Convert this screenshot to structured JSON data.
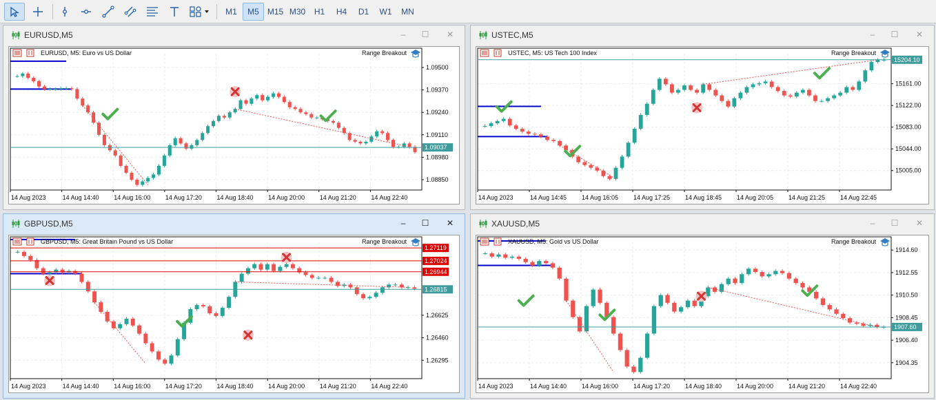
{
  "toolbar": {
    "tools": [
      {
        "name": "cursor-tool-button",
        "icon": "cursor-icon",
        "active": true
      },
      {
        "name": "crosshair-tool-button",
        "icon": "crosshair-icon",
        "active": false
      },
      {
        "name": "vertical-line-tool-button",
        "icon": "vertical-line-icon",
        "active": false
      },
      {
        "name": "horizontal-line-tool-button",
        "icon": "horizontal-line-icon",
        "active": false
      },
      {
        "name": "trendline-tool-button",
        "icon": "trendline-icon",
        "active": false
      },
      {
        "name": "channel-tool-button",
        "icon": "channel-icon",
        "active": false
      },
      {
        "name": "fibonacci-tool-button",
        "icon": "fibonacci-icon",
        "active": false
      },
      {
        "name": "text-tool-button",
        "icon": "text-icon",
        "active": false
      },
      {
        "name": "shapes-tool-button",
        "icon": "shapes-icon",
        "active": false
      }
    ],
    "timeframes": [
      "M1",
      "M5",
      "M15",
      "M30",
      "H1",
      "H4",
      "D1",
      "W1",
      "MN"
    ],
    "active_timeframe": "M5"
  },
  "colors": {
    "bull": "#26a69a",
    "bear": "#ef5350",
    "blue_line": "#0000cc",
    "price_line": "#3f9c9c",
    "red_level": "#e00000",
    "check": "#4caf50",
    "cross": "#d33434"
  },
  "windows": [
    {
      "key": "eurusd",
      "title": "EURUSD,M5",
      "description": "EURUSD, M5:  Euro vs US Dollar",
      "indicator": "Range Breakout",
      "active": false,
      "y_ticks": [
        "1.09500",
        "1.09370",
        "1.09240",
        "1.09110",
        "1.08980",
        "1.08850"
      ],
      "price_tag": "1.09037",
      "level_tags": [],
      "x_ticks": [
        "14 Aug 2023",
        "14 Aug 14:40",
        "14 Aug 16:00",
        "14 Aug 17:20",
        "14 Aug 18:40",
        "14 Aug 20:00",
        "14 Aug 21:20",
        "14 Aug 22:40"
      ],
      "chart_data": {
        "type": "candlestick",
        "ylim": [
          1.0879,
          1.0958
        ],
        "close": [
          1.0945,
          1.09465,
          1.0944,
          1.0942,
          1.0939,
          1.09375,
          1.09375,
          1.09375,
          1.0938,
          1.0938,
          1.09375,
          1.0932,
          1.0928,
          1.0924,
          1.0918,
          1.0911,
          1.0905,
          1.0902,
          1.0899,
          1.0893,
          1.0889,
          1.0885,
          1.0882,
          1.0884,
          1.0886,
          1.0888,
          1.0893,
          1.0899,
          1.0905,
          1.0909,
          1.0906,
          1.0903,
          1.0905,
          1.0908,
          1.0912,
          1.0916,
          1.0919,
          1.0922,
          1.0921,
          1.0924,
          1.0926,
          1.0931,
          1.0929,
          1.0932,
          1.0934,
          1.0931,
          1.0933,
          1.0935,
          1.0933,
          1.093,
          1.0927,
          1.0926,
          1.0924,
          1.0923,
          1.0921,
          1.0921,
          1.092,
          1.0919,
          1.0918,
          1.0915,
          1.0912,
          1.0908,
          1.0907,
          1.0906,
          1.0907,
          1.091,
          1.0913,
          1.0912,
          1.0908,
          1.0904,
          1.0904,
          1.0906,
          1.0904,
          1.0901
        ]
      },
      "markers": [
        {
          "kind": "check",
          "i": 17,
          "y": 1.0923
        },
        {
          "kind": "cross",
          "i": 40,
          "y": 1.0936
        },
        {
          "kind": "check",
          "i": 57,
          "y": 1.0922
        }
      ]
    },
    {
      "key": "ustec",
      "title": "USTEC,M5",
      "description": "USTEC, M5:  US Tech 100 Index",
      "indicator": "Range Breakout",
      "active": false,
      "y_ticks": [
        "15161.00",
        "15122.00",
        "15083.00",
        "15044.00",
        "15005.00"
      ],
      "price_tag": "15204.10",
      "level_tags": [],
      "x_ticks": [
        "14 Aug 2023",
        "14 Aug 14:45",
        "14 Aug 16:05",
        "14 Aug 17:25",
        "14 Aug 18:45",
        "14 Aug 20:05",
        "14 Aug 21:25",
        "14 Aug 22:45"
      ],
      "chart_data": {
        "type": "candlestick",
        "ylim": [
          14970,
          15215
        ],
        "close": [
          15085,
          15090,
          15094,
          15098,
          15086,
          15080,
          15075,
          15071,
          15070,
          15066,
          15060,
          15058,
          15050,
          15042,
          15030,
          15020,
          15015,
          15010,
          15005,
          14995,
          14990,
          15010,
          15030,
          15055,
          15080,
          15105,
          15125,
          15150,
          15170,
          15160,
          15145,
          15150,
          15158,
          15150,
          15145,
          15160,
          15150,
          15140,
          15130,
          15120,
          15135,
          15145,
          15155,
          15160,
          15162,
          15165,
          15155,
          15148,
          15140,
          15138,
          15145,
          15150,
          15140,
          15130,
          15130,
          15135,
          15140,
          15145,
          15155,
          15150,
          15165,
          15185,
          15200,
          15204,
          15204
        ]
      },
      "markers": [
        {
          "kind": "check",
          "i": 3,
          "y": 15120
        },
        {
          "kind": "check",
          "i": 14,
          "y": 15040
        },
        {
          "kind": "cross",
          "i": 34,
          "y": 15118
        },
        {
          "kind": "check",
          "i": 54,
          "y": 15180
        }
      ]
    },
    {
      "key": "gbpusd",
      "title": "GBPUSD,M5",
      "description": "GBPUSD, M5:  Great Britain Pound vs US Dollar",
      "indicator": "Range Breakout",
      "active": true,
      "y_ticks": [
        "1.26625",
        "1.26460",
        "1.26295"
      ],
      "price_tag": "1.26815",
      "level_tags": [
        "1.27119",
        "1.27024",
        "1.26944"
      ],
      "x_ticks": [
        "14 Aug 2023",
        "14 Aug 14:40",
        "14 Aug 16:00",
        "14 Aug 17:20",
        "14 Aug 18:40",
        "14 Aug 20:00",
        "14 Aug 21:20",
        "14 Aug 22:40"
      ],
      "chart_data": {
        "type": "candlestick",
        "ylim": [
          1.2616,
          1.2716
        ],
        "close": [
          1.2709,
          1.2706,
          1.2703,
          1.2697,
          1.2693,
          1.2694,
          1.2696,
          1.2694,
          1.2695,
          1.2693,
          1.2687,
          1.268,
          1.2672,
          1.2665,
          1.2658,
          1.2653,
          1.2656,
          1.266,
          1.2655,
          1.2649,
          1.2642,
          1.2636,
          1.263,
          1.2627,
          1.2633,
          1.2645,
          1.2657,
          1.2667,
          1.267,
          1.2669,
          1.2664,
          1.2662,
          1.2668,
          1.2676,
          1.2687,
          1.2693,
          1.2697,
          1.27,
          1.2696,
          1.27,
          1.2695,
          1.2698,
          1.27,
          1.2697,
          1.2694,
          1.2692,
          1.269,
          1.269,
          1.269,
          1.2687,
          1.2684,
          1.2685,
          1.2683,
          1.2678,
          1.2675,
          1.2676,
          1.2679,
          1.2683,
          1.2685,
          1.2685,
          1.2683,
          1.2683,
          1.2682
        ]
      },
      "markers": [
        {
          "kind": "cross",
          "i": 5,
          "y": 1.2688
        },
        {
          "kind": "check",
          "i": 26,
          "y": 1.2658
        },
        {
          "kind": "cross",
          "i": 36,
          "y": 1.2648
        },
        {
          "kind": "cross",
          "i": 42,
          "y": 1.2705
        }
      ]
    },
    {
      "key": "xauusd",
      "title": "XAUUSD,M5",
      "description": "XAUUSD, M5:  Gold vs US Dollar",
      "indicator": "Range Breakout",
      "active": false,
      "y_ticks": [
        "1914.60",
        "1912.55",
        "1910.50",
        "1908.45",
        "1906.40",
        "1904.35"
      ],
      "price_tag": "1907.60",
      "level_tags": [],
      "x_ticks": [
        "14 Aug 2023",
        "14 Aug 14:40",
        "14 Aug 16:00",
        "14 Aug 17:20",
        "14 Aug 18:40",
        "14 Aug 20:00",
        "14 Aug 21:20",
        "14 Aug 22:40"
      ],
      "chart_data": {
        "type": "candlestick",
        "ylim": [
          1902.9,
          1915.3
        ],
        "close": [
          1914.3,
          1914.0,
          1914.2,
          1913.9,
          1914.0,
          1913.8,
          1913.5,
          1913.2,
          1913.6,
          1913.4,
          1913.0,
          1912.0,
          1910.0,
          1908.5,
          1907.2,
          1909.5,
          1911.0,
          1909.8,
          1908.5,
          1907.0,
          1905.5,
          1904.0,
          1903.5,
          1904.8,
          1907.0,
          1909.5,
          1910.5,
          1909.8,
          1909.0,
          1909.4,
          1910.0,
          1909.5,
          1910.4,
          1911.2,
          1910.8,
          1911.5,
          1912.0,
          1911.6,
          1912.4,
          1912.9,
          1912.6,
          1912.2,
          1912.4,
          1912.7,
          1912.5,
          1912.0,
          1911.6,
          1911.2,
          1910.8,
          1910.2,
          1909.6,
          1909.2,
          1908.8,
          1908.4,
          1908.0,
          1907.9,
          1907.7,
          1907.8,
          1907.6,
          1907.6
        ]
      },
      "markers": [
        {
          "kind": "check",
          "i": 6,
          "y": 1910.0
        },
        {
          "kind": "check",
          "i": 18,
          "y": 1908.7
        },
        {
          "kind": "cross",
          "i": 32,
          "y": 1910.4
        },
        {
          "kind": "check",
          "i": 48,
          "y": 1910.9
        }
      ]
    }
  ]
}
